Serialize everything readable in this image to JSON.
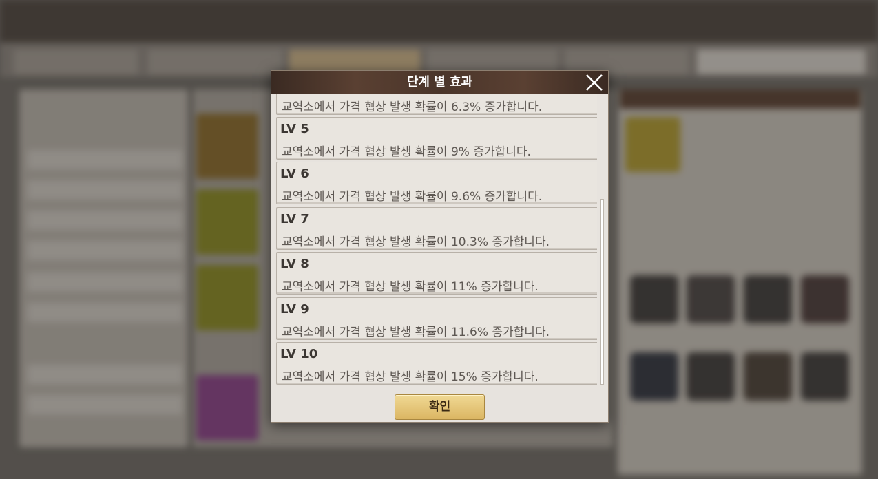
{
  "modal": {
    "title": "단계 별 효과",
    "close_icon": "close-icon",
    "confirm_label": "확인",
    "levels": [
      {
        "label": "",
        "desc": "교역소에서 가격 협상 발생 확률이 6.3% 증가합니다."
      },
      {
        "label": "LV 5",
        "desc": "교역소에서 가격 협상 발생 확률이 9% 증가합니다."
      },
      {
        "label": "LV 6",
        "desc": "교역소에서 가격 협상 발생 확률이 9.6% 증가합니다."
      },
      {
        "label": "LV 7",
        "desc": "교역소에서 가격 협상 발생 확률이 10.3% 증가합니다."
      },
      {
        "label": "LV 8",
        "desc": "교역소에서 가격 협상 발생 확률이 11% 증가합니다."
      },
      {
        "label": "LV 9",
        "desc": "교역소에서 가격 협상 발생 확률이 11.6% 증가합니다."
      },
      {
        "label": "LV 10",
        "desc": "교역소에서 가격 협상 발생 확률이 15% 증가합니다."
      }
    ]
  },
  "colors": {
    "header_bg": "#4a352a",
    "panel_bg": "#e7e3de",
    "confirm_gold": "#e4c474",
    "text_dark": "#3c3733"
  }
}
